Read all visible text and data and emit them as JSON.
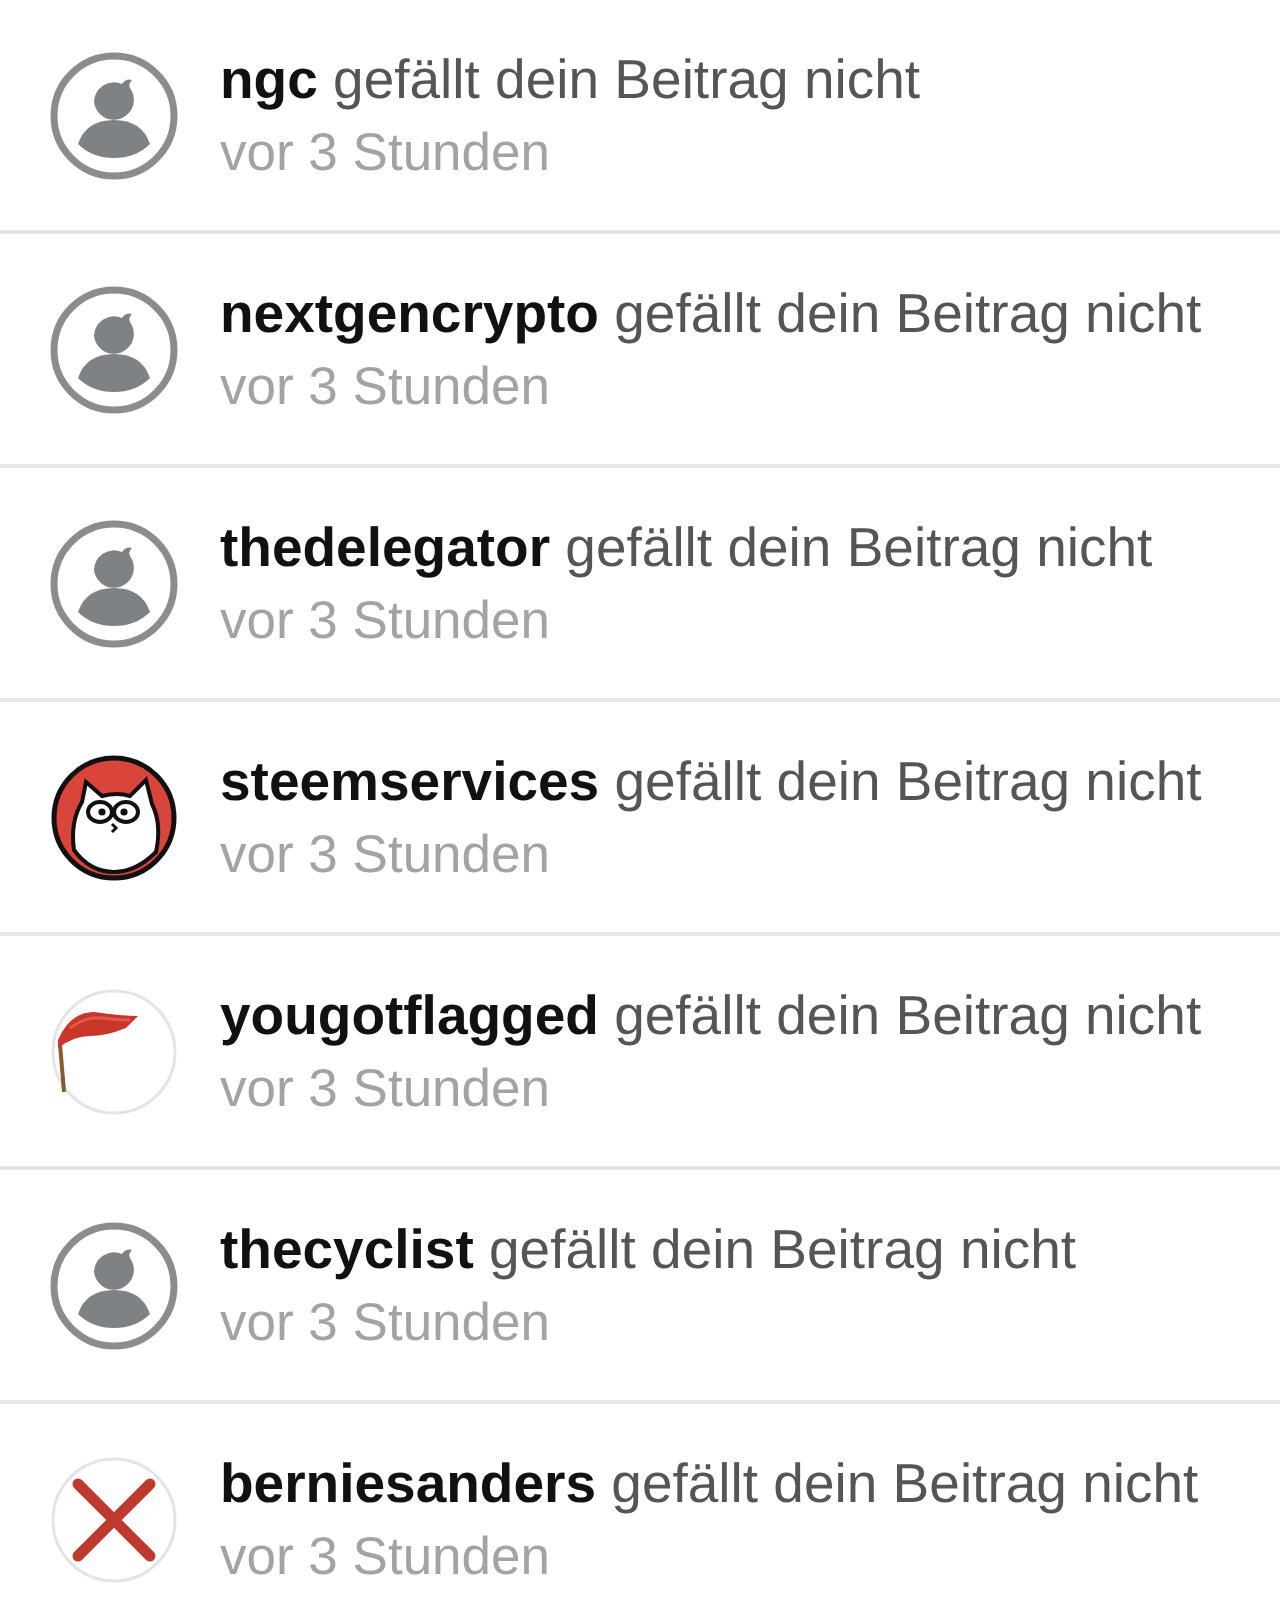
{
  "notifications": [
    {
      "kind": "silhouette",
      "user": "ngc",
      "action": "gefällt dein Beitrag nicht",
      "time": "vor 3 Stunden"
    },
    {
      "kind": "silhouette",
      "user": "nextgencrypto",
      "action": "gefällt dein Beitrag nicht",
      "time": "vor 3 Stunden"
    },
    {
      "kind": "silhouette",
      "user": "thedelegator",
      "action": "gefällt dein Beitrag nicht",
      "time": "vor 3 Stunden"
    },
    {
      "kind": "cat",
      "user": "steemservices",
      "action": "gefällt dein Beitrag nicht",
      "time": "vor 3 Stunden"
    },
    {
      "kind": "flag",
      "user": "yougotflagged",
      "action": "gefällt dein Beitrag nicht",
      "time": "vor 3 Stunden"
    },
    {
      "kind": "silhouette",
      "user": "thecyclist",
      "action": "gefällt dein Beitrag nicht",
      "time": "vor 3 Stunden"
    },
    {
      "kind": "cross",
      "user": "berniesanders",
      "action": "gefällt dein Beitrag nicht",
      "time": "vor 3 Stunden"
    }
  ]
}
